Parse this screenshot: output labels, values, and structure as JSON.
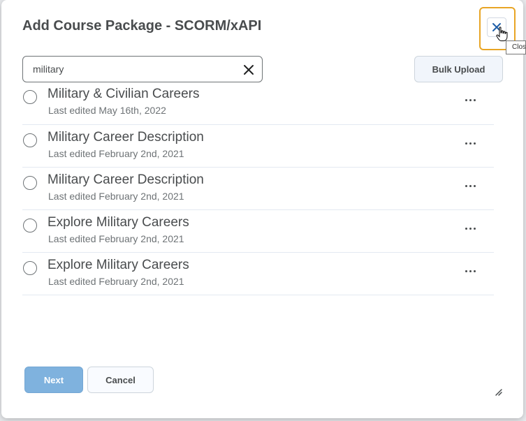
{
  "dialog": {
    "title": "Add Course Package - SCORM/xAPI",
    "close_tooltip": "Close",
    "search": {
      "value": "military",
      "clear_icon": "close-icon"
    },
    "bulk_upload_label": "Bulk Upload",
    "items": [
      {
        "title": "Military & Civilian Careers",
        "subtitle": "Last edited May 16th, 2022"
      },
      {
        "title": "Military Career Description",
        "subtitle": "Last edited February 2nd, 2021"
      },
      {
        "title": "Military Career Description",
        "subtitle": "Last edited February 2nd, 2021"
      },
      {
        "title": "Explore Military Careers",
        "subtitle": "Last edited February 2nd, 2021"
      },
      {
        "title": "Explore Military Careers",
        "subtitle": "Last edited February 2nd, 2021"
      }
    ],
    "footer": {
      "next_label": "Next",
      "cancel_label": "Cancel"
    },
    "colors": {
      "accent": "#7fb2de",
      "focus": "#e8a525",
      "close_icon": "#1f5fa8"
    }
  }
}
